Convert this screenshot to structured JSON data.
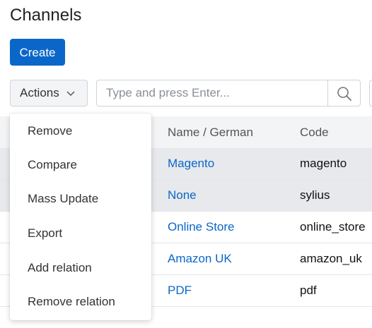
{
  "page": {
    "title": "Channels"
  },
  "toolbar": {
    "create_label": "Create",
    "actions_label": "Actions",
    "search_placeholder": "Type and press Enter..."
  },
  "actions_menu": {
    "items": [
      "Remove",
      "Compare",
      "Mass Update",
      "Export",
      "Add relation",
      "Remove relation"
    ]
  },
  "table": {
    "columns": [
      "Name / German",
      "Code"
    ],
    "rows": [
      {
        "name": "Magento",
        "code": "magento",
        "selected": true
      },
      {
        "name": "None",
        "code": "sylius",
        "selected": true
      },
      {
        "name": "Online Store",
        "code": "online_store",
        "selected": false
      },
      {
        "name": "Amazon UK",
        "code": "amazon_uk",
        "selected": false
      },
      {
        "name": "PDF",
        "code": "pdf",
        "selected": false
      }
    ]
  },
  "colors": {
    "accent": "#0a67c9",
    "selected_row": "#e7e9ec",
    "header_bg": "#f3f4f6"
  },
  "icons": {
    "actions_chevron": "chevron-down-icon",
    "search": "search-icon"
  }
}
